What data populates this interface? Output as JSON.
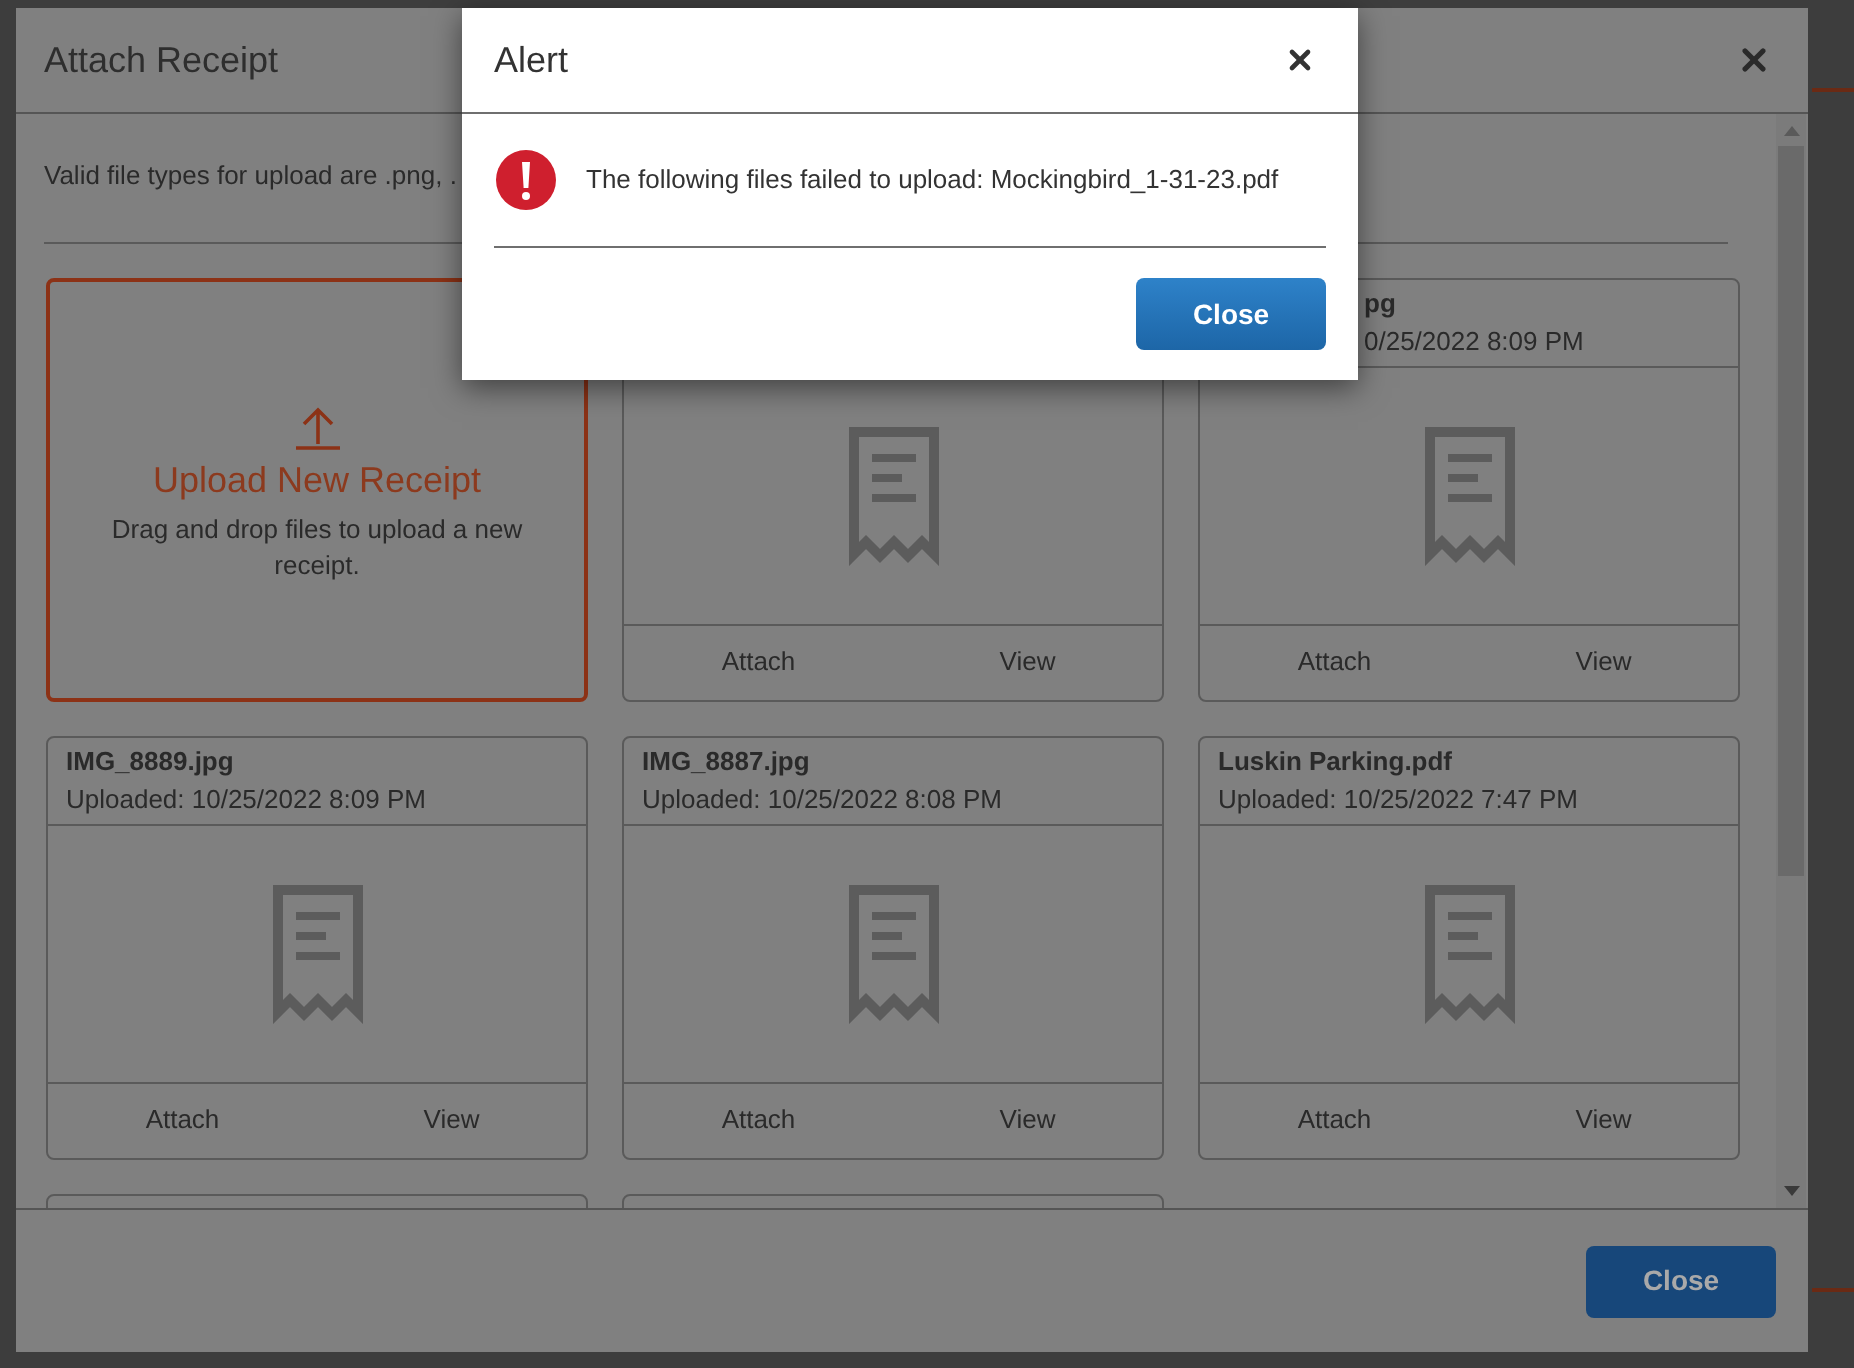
{
  "attach_dialog": {
    "title": "Attach Receipt",
    "instructions": "Valid file types for upload are .png, .",
    "upload_tile": {
      "title": "Upload New Receipt",
      "hint": "Drag and drop files to upload a new receipt."
    },
    "receipts": [
      {
        "actions": [
          "Attach",
          "View"
        ]
      },
      {
        "name": "pg",
        "uploaded": "0/25/2022 8:09 PM",
        "clipped": true,
        "actions": [
          "Attach",
          "View"
        ]
      },
      {
        "name": "IMG_8889.jpg",
        "uploaded": "Uploaded: 10/25/2022 8:09 PM",
        "clipped": false,
        "actions": [
          "Attach",
          "View"
        ]
      },
      {
        "name": "IMG_8887.jpg",
        "uploaded": "Uploaded: 10/25/2022 8:08 PM",
        "clipped": false,
        "actions": [
          "Attach",
          "View"
        ]
      },
      {
        "name": "Luskin Parking.pdf",
        "uploaded": "Uploaded: 10/25/2022 7:47 PM",
        "clipped": false,
        "actions": [
          "Attach",
          "View"
        ]
      }
    ],
    "close_button": "Close"
  },
  "alert": {
    "title": "Alert",
    "message": "The following files failed to upload: Mockingbird_1-31-23.pdf",
    "button": "Close"
  }
}
